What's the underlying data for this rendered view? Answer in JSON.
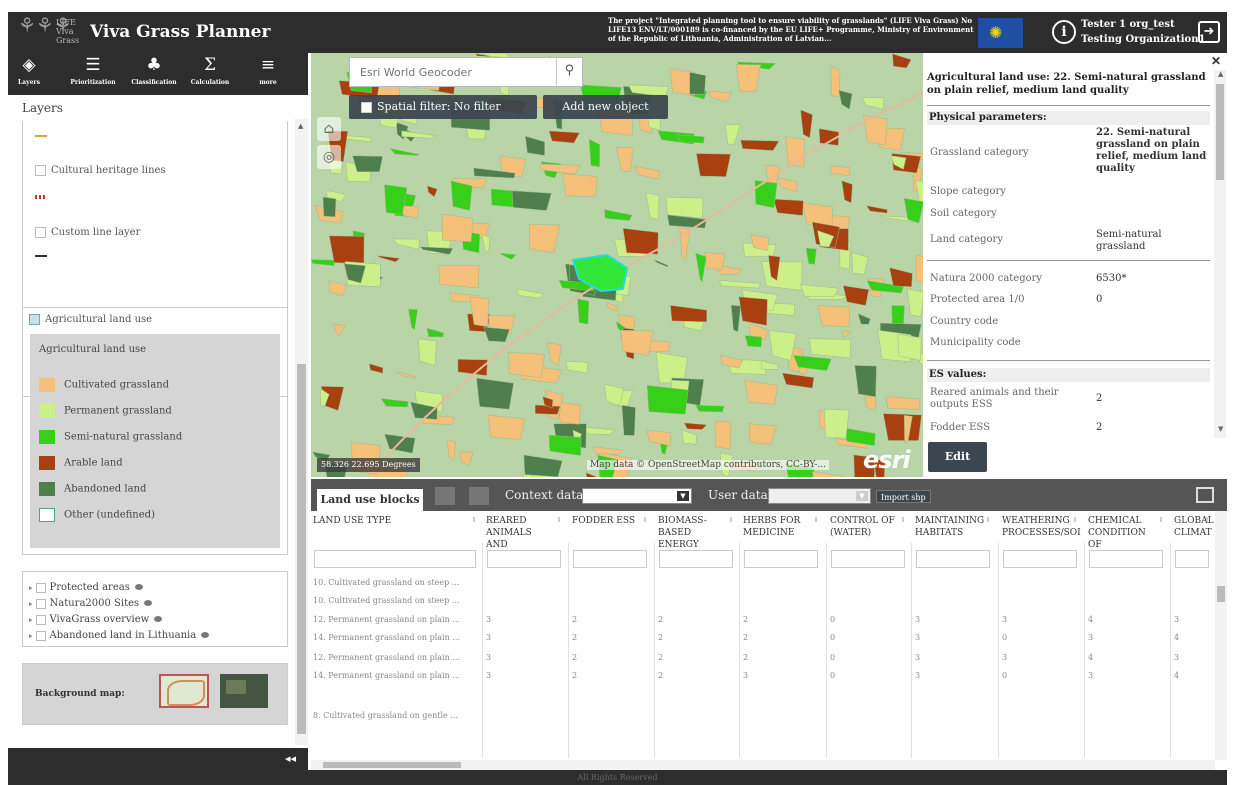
{
  "header": {
    "logo_text": "LIFE Viva Grass",
    "app_title": "Viva Grass Planner",
    "project_note": "The project \"Integrated planning tool to ensure viability of grasslands\" (LIFE Viva Grass) No LIFE13 ENV/LT/000189 is co-financed by the EU LIFE+ Programme, Ministry of Environment of the Republic of Lithuania, Administration of Latvian...",
    "user_name": "Tester 1 org_test",
    "user_org": "Testing Organization1"
  },
  "toolbar": {
    "items": [
      {
        "icon": "layers-icon",
        "label": "Layers"
      },
      {
        "icon": "prioritization-icon",
        "label": "Prioritization"
      },
      {
        "icon": "classification-icon",
        "label": "Classification"
      },
      {
        "icon": "calculation-icon",
        "label": "Calculation"
      },
      {
        "icon": "more-icon",
        "label": "more"
      }
    ]
  },
  "layers": {
    "title": "Layers",
    "line_layers": [
      "Cultural heritage lines",
      "Custom line layer"
    ],
    "agri_layer": "Agricultural land use",
    "legend_title": "Agricultural land use",
    "legend": [
      {
        "label": "Cultivated grassland",
        "color": "#f5c07a"
      },
      {
        "label": "Permanent grassland",
        "color": "#ccef8a"
      },
      {
        "label": "Semi-natural grassland",
        "color": "#36d01a"
      },
      {
        "label": "Arable land",
        "color": "#a8410f"
      },
      {
        "label": "Abandoned land",
        "color": "#4f7f4d"
      },
      {
        "label": "Other (undefined)",
        "color": "#ffffff"
      }
    ],
    "overlays": [
      "Protected areas",
      "Natura2000 Sites",
      "VivaGrass overview",
      "Abandoned land in Lithuania"
    ],
    "background_label": "Background map:"
  },
  "map": {
    "search_placeholder": "Esri World Geocoder",
    "spatial_filter": "Spatial filter: No filter",
    "add_object": "Add new object",
    "coords": "58.326 22.695 Degrees",
    "attribution": "Map data © OpenStreetMap contributors, CC-BY-...",
    "esri": "esri"
  },
  "info": {
    "title": "Agricultural land use: 22. Semi-natural grassland on plain relief, medium land quality",
    "physical_header": "Physical parameters:",
    "physical": [
      {
        "key": "Grassland category",
        "value": "22. Semi-natural grassland on plain relief, medium land quality"
      },
      {
        "key": "Slope category",
        "value": ""
      },
      {
        "key": "Soil category",
        "value": ""
      },
      {
        "key": "Land category",
        "value": "Semi-natural grassland"
      },
      {
        "key": "Natura 2000 category",
        "value": "6530*"
      },
      {
        "key": "Protected area 1/0",
        "value": "0"
      },
      {
        "key": "Country code",
        "value": ""
      },
      {
        "key": "Municipality code",
        "value": ""
      }
    ],
    "es_header": "ES values:",
    "es": [
      {
        "key": "Reared animals and their outputs ESS",
        "value": "2"
      },
      {
        "key": "Fodder ESS",
        "value": "2"
      }
    ],
    "edit": "Edit"
  },
  "table": {
    "tab": "Land use blocks",
    "context_label": "Context data:",
    "user_label": "User data",
    "import_shp": "Import shp",
    "columns": [
      "LAND USE TYPE",
      "REARED ANIMALS AND",
      "FODDER ESS",
      "BIOMASS-BASED ENERGY",
      "HERBS FOR MEDICINE",
      "CONTROL OF (WATER)",
      "MAINTAINING HABITATS",
      "WEATHERING PROCESSES/SOI",
      "CHEMICAL CONDITION OF",
      "GLOBAL CLIMAT"
    ],
    "rows": [
      [
        "10. Cultivated grassland on steep ...",
        "",
        "",
        "",
        "",
        "",
        "",
        "",
        "",
        ""
      ],
      [
        "10. Cultivated grassland on steep ...",
        "",
        "",
        "",
        "",
        "",
        "",
        "",
        "",
        ""
      ],
      [
        "12. Permanent grassland on plain ...",
        "3",
        "2",
        "2",
        "2",
        "0",
        "3",
        "3",
        "4",
        "3"
      ],
      [
        "14. Permanent grassland on plain ...",
        "3",
        "2",
        "2",
        "2",
        "0",
        "3",
        "0",
        "3",
        "4"
      ],
      [
        "12. Permanent grassland on plain ...",
        "3",
        "2",
        "2",
        "2",
        "0",
        "3",
        "3",
        "4",
        "3"
      ],
      [
        "14. Permanent grassland on plain ...",
        "3",
        "2",
        "2",
        "3",
        "0",
        "3",
        "0",
        "3",
        "4"
      ],
      [
        "",
        "",
        "",
        "",
        "",
        "",
        "",
        "",
        "",
        ""
      ],
      [
        "8. Cultivated grassland on gentle ...",
        "",
        "",
        "",
        "",
        "",
        "",
        "",
        "",
        ""
      ]
    ]
  },
  "footer": {
    "collapse": "◂◂",
    "status": "All Rights Reserved"
  }
}
